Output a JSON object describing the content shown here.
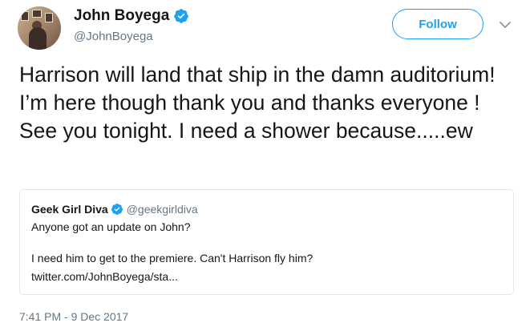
{
  "author": {
    "display_name": "John Boyega",
    "handle": "@JohnBoyega",
    "verified": true
  },
  "actions": {
    "follow_label": "Follow"
  },
  "tweet": {
    "text": "Harrison will land that ship in the damn auditorium!  I’m here though thank you and thanks everyone ! See you tonight. I need a shower because.....ew",
    "timestamp": "7:41 PM - 9 Dec 2017"
  },
  "quoted_tweet": {
    "display_name": "Geek Girl Diva",
    "handle": "@geekgirldiva",
    "verified": true,
    "line1": "Anyone got an update on John?",
    "line2": "I need him to get to the premiere. Can't Harrison fly him?",
    "link": "twitter.com/JohnBoyega/sta..."
  },
  "colors": {
    "accent": "#1da1f2",
    "text": "#14171a",
    "muted": "#657786",
    "border": "#e1e8ed"
  },
  "icons": [
    "verified-badge-icon",
    "chevron-down-icon"
  ]
}
